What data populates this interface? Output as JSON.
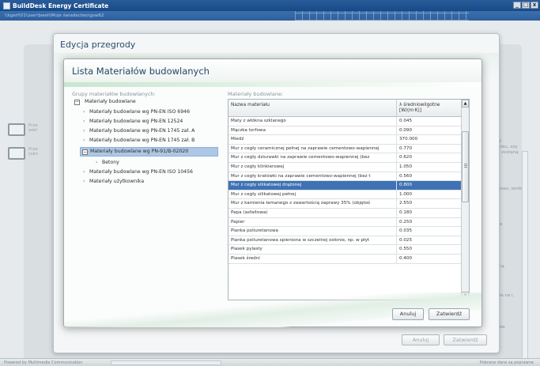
{
  "window": {
    "title": "BuildDesk Energy Certificate",
    "path": "\\\\kgerf\\01\\user\\bwell\\Moje świadectwo\\gsw62",
    "controls": [
      "_",
      "□",
      "x"
    ]
  },
  "background": {
    "side_items": [
      {
        "icon": "wall-icon",
        "text": "Prze wiel"
      },
      {
        "icon": "window-icon",
        "text": "Prze (okn"
      }
    ],
    "right_texts": [
      "ne:",
      "egród budynku, ozy zekie zostaną",
      "e je towo, ienik",
      "usi we",
      "enu i",
      "niejscą,",
      "ch tala na l, która",
      "ch roda"
    ]
  },
  "outer_dialog": {
    "title": "Edycja przegrody",
    "cancel_label": "Anuluj",
    "confirm_label": "Zatwierdź"
  },
  "inner_dialog": {
    "title": "Lista Materiałów budowlanych",
    "groups_label": "Grupy materiałów budowlanych:",
    "materials_label": "Materiały budowlane:",
    "tree": {
      "root": "Materiały budowlane",
      "items": [
        "Materiały budowlane wg PN-EN ISO 6946",
        "Materiały budowlane wg PN-EN 12524",
        "Materiały budowlane wg PN-EN 1745 zał. A",
        "Materiały budowlane wg PN-EN 1745 zał. B"
      ],
      "selected": "Materiały budowlane wg PN-91/B-02020",
      "selected_child": "Betony",
      "after": [
        "Materiały budowlane wg PN-EN ISO 10456",
        "Materiały użytkownika"
      ]
    },
    "table": {
      "headers": {
        "name": "Nazwa materiału",
        "value": "λ średniowilgotne [W/(m·K)]"
      },
      "rows": [
        {
          "name": "Maty z włókna szklanego",
          "value": "0.045"
        },
        {
          "name": "Mączka torfowa",
          "value": "0.090"
        },
        {
          "name": "Miedź",
          "value": "370.000"
        },
        {
          "name": "Mur z cegły ceramicznej pełnej na zaprawie cementowo-wapiennej",
          "value": "0.770"
        },
        {
          "name": "Mur z cegły dziurawki na zaprawie cementowo-wapiennej (bez",
          "value": "0.620"
        },
        {
          "name": "Mur z cegły klinkierowej",
          "value": "1.050"
        },
        {
          "name": "Mur z cegły kratówki na zaprawie cementowo-wapiennej (bez t",
          "value": "0.560"
        },
        {
          "name": "Mur z cegły silikatowej drążonej",
          "value": "0.800"
        },
        {
          "name": "Mur z cegły silikatowej pełnej",
          "value": "1.000"
        },
        {
          "name": "Mur z kamienia łamanego z zawartością zaprawy 35% (objętoś",
          "value": "2.550"
        },
        {
          "name": "Papa (asfaltowa)",
          "value": "0.180"
        },
        {
          "name": "Papier",
          "value": "0.250"
        },
        {
          "name": "Pianka poliuretanowa",
          "value": "0.035"
        },
        {
          "name": "Pianka poliuretanowa spieniona w szczelnej osłonie, np. w płyt",
          "value": "0.025"
        },
        {
          "name": "Piasek pylasty",
          "value": "0.550"
        },
        {
          "name": "Piasek średni",
          "value": "0.400"
        }
      ],
      "selected_index": 7
    },
    "cancel_label": "Anuluj",
    "confirm_label": "Zatwierdź"
  },
  "statusbar": {
    "left": "Powered by Multimedia Communication",
    "right": "Pobrane dane są poprawne"
  }
}
